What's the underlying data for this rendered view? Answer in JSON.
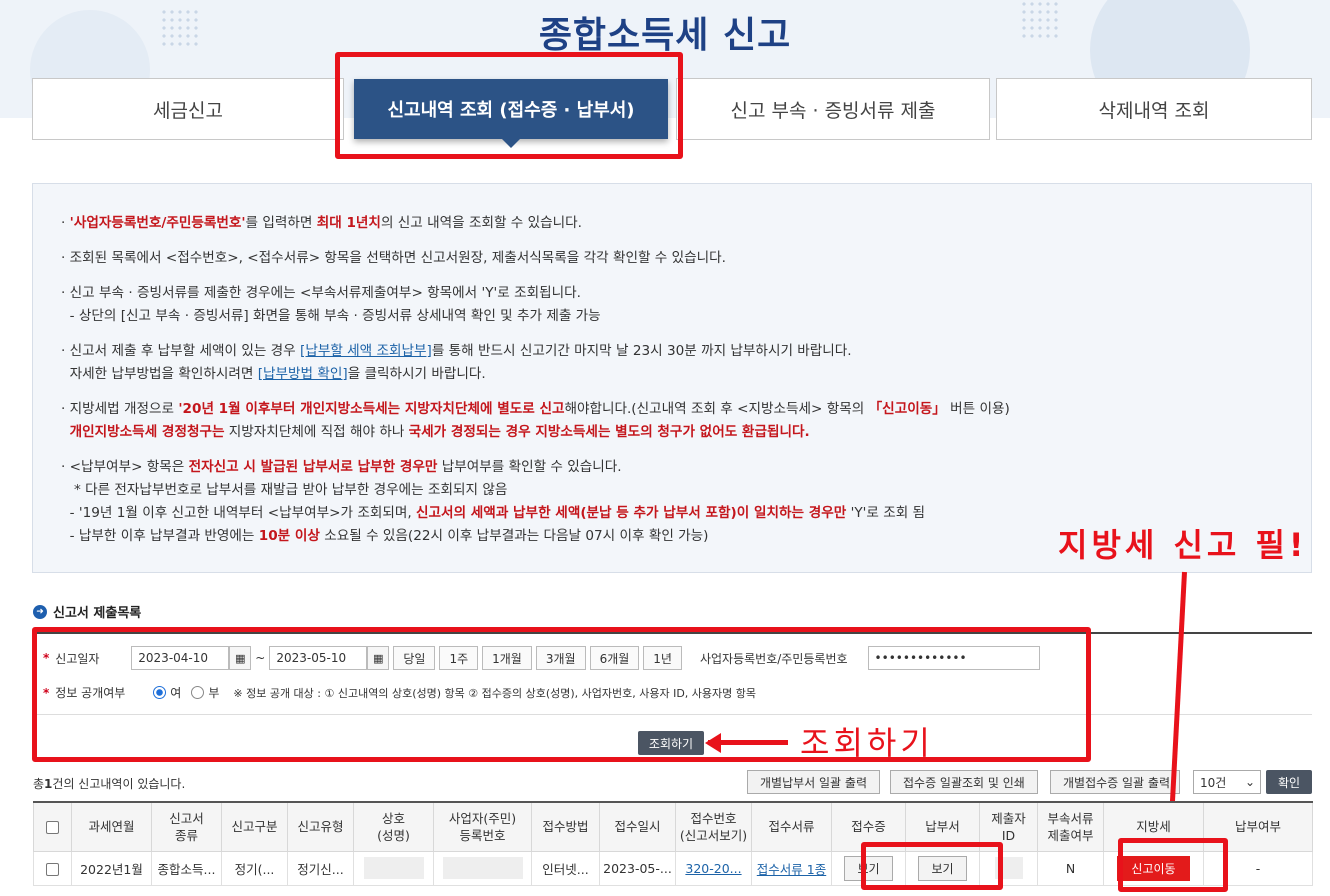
{
  "page_title": "종합소득세 신고",
  "tabs": [
    {
      "label": "세금신고"
    },
    {
      "label": "신고내역 조회 (접수증 · 납부서)"
    },
    {
      "label": "신고 부속 · 증빙서류 제출"
    },
    {
      "label": "삭제내역 조회"
    }
  ],
  "notice": {
    "p1": {
      "a": "'사업자등록번호/주민등록번호'",
      "b": "를 입력하면 ",
      "c": "최대 1년치",
      "d": "의 신고 내역을 조회할 수 있습니다."
    },
    "p2": "조회된 목록에서 <접수번호>, <접수서류> 항목을 선택하면 신고서원장, 제출서식목록을 각각 확인할 수 있습니다.",
    "p3a": "신고 부속 · 증빙서류를 제출한 경우에는 <부속서류제출여부> 항목에서 'Y'로 조회됩니다.",
    "p3b": "- 상단의 [신고 부속 · 증빙서류] 화면을 통해 부속 · 증빙서류 상세내역 확인 및 추가 제출 가능",
    "p4": {
      "a": "신고서 제출 후 납부할 세액이 있는 경우 ",
      "link1": "[납부할 세액 조회납부]",
      "b": "를 통해 반드시 신고기간 마지막 날 23시 30분 까지 납부하시기 바랍니다.",
      "c": "자세한 납부방법을 확인하시려면 ",
      "link2": "[납부방법 확인]",
      "d": "을 클릭하시기 바랍니다."
    },
    "p5": {
      "a": "지방세법 개정으로 ",
      "b": "'20년 1월 이후부터 개인지방소득세는 지방자치단체에 별도로 신고",
      "c": "해야합니다.(신고내역 조회 후 <지방소득세> 항목의 ",
      "d": "「신고이동」",
      "e": " 버튼 이용)",
      "f": "개인지방소득세 경정청구는",
      "g": " 지방자치단체에 직접 해야 하나 ",
      "h": "국세가 경정되는 경우 지방소득세는 별도의 청구가 없어도 환급됩니다."
    },
    "p6": {
      "a": "<납부여부> 항목은 ",
      "b": "전자신고 시 발급된 납부서로 납부한 경우만",
      "c": " 납부여부를 확인할 수 있습니다.",
      "d": "* 다른 전자납부번호로 납부서를 재발급 받아 납부한 경우에는 조회되지 않음",
      "e": "- '19년 1월 이후 신고한 내역부터 <납부여부>가 조회되며, ",
      "f": "신고서의 세액과 납부한 세액(분납 등 추가 납부서 포함)이 일치하는 경우만",
      "g": " 'Y'로 조회 됨",
      "h": "- 납부한 이후 납부결과 반영에는 ",
      "i": "10분 이상",
      "j": " 소요될 수 있음(22시 이후 납부결과는 다음날 07시 이후 확인 가능)"
    }
  },
  "annotations": {
    "local_tax": "지방세 신고 필!",
    "search": "조회하기"
  },
  "section_title": "신고서 제출목록",
  "search": {
    "date_label": "신고일자",
    "date_from": "2023-04-10",
    "date_sep": "~",
    "date_to": "2023-05-10",
    "periods": [
      "당일",
      "1주",
      "1개월",
      "3개월",
      "6개월",
      "1년"
    ],
    "id_label": "사업자등록번호/주민등록번호",
    "id_value": "•••••••••••••",
    "public_label": "정보 공개여부",
    "yes": "여",
    "no": "부",
    "public_note": "※ 정보 공개 대상 : ① 신고내역의 상호(성명) 항목 ② 접수증의 상호(성명), 사업자번호, 사용자 ID, 사용자명 항목",
    "search_btn": "조회하기"
  },
  "result": {
    "count_pre": "총",
    "count_num": "1",
    "count_post": "건의 신고내역이 있습니다.",
    "btn_print_payment": "개별납부서 일괄 출력",
    "btn_print_receipt": "접수증 일괄조회 및 인쇄",
    "btn_print_individual": "개별접수증 일괄 출력",
    "page_size": "10건",
    "confirm": "확인"
  },
  "table": {
    "headers": [
      "",
      "과세연월",
      "신고서\n종류",
      "신고구분",
      "신고유형",
      "상호\n(성명)",
      "사업자(주민)\n등록번호",
      "접수방법",
      "접수일시",
      "접수번호\n(신고서보기)",
      "접수서류",
      "접수증",
      "납부서",
      "제출자\nID",
      "부속서류\n제출여부",
      "지방세",
      "납부여부"
    ],
    "row": {
      "period": "2022년1월",
      "kind": "종합소득...",
      "division": "정기(...",
      "type": "정기신...",
      "method": "인터넷...",
      "datetime": "2023-05-...",
      "receipt_no": "320-20...",
      "docs": "접수서류 1종",
      "view1": "보기",
      "view2": "보기",
      "attached": "N",
      "move": "신고이동",
      "paid": "-"
    }
  }
}
